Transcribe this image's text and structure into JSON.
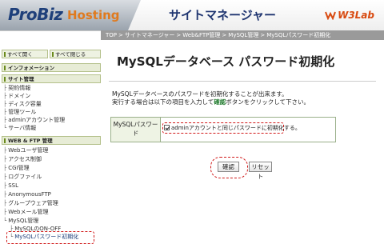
{
  "header": {
    "logo_main": "ProBiz",
    "logo_sub": "Hosting",
    "site_title": "サイトマネージャー",
    "brand": "W3Lab"
  },
  "breadcrumb": [
    "TOP",
    "サイトマネージャー",
    "Web&FTP管理",
    "MySQL管理",
    "MySQLパスワード初期化"
  ],
  "sidebar": {
    "open_all": "すべて開く",
    "close_all": "すべて閉じる",
    "sections": {
      "info": "インフォメーション",
      "site": "サイト管理",
      "webftp": "WEB & FTP 管理"
    },
    "site_items": [
      "契約情報",
      "ドメイン",
      "ディスク容量",
      "管理ツール",
      "adminアカウント管理",
      "サーバ情報"
    ],
    "webftp_items": [
      "Webユーザ管理",
      "アクセス制御",
      "CGI管理",
      "ログファイル",
      "SSL",
      "AnonymousFTP",
      "グループウェア管理",
      "Webメール管理",
      "MySQL管理"
    ],
    "mysql_items": [
      "MySQLのON-OFF",
      "MySQLパスワード初期化"
    ]
  },
  "main": {
    "title": "MySQLデータベース パスワード初期化",
    "desc_line1": "MySQLデータベースのパスワードを初期化することが出来ます。",
    "desc_line2_pre": "実行する場合は以下の項目を入力して",
    "desc_line2_kw": "確認",
    "desc_line2_post": "ボタンをクリックして下さい。",
    "form_label": "MySQLパスワード",
    "checkbox_label": "adminアカウントと同じパスワードに初期化する。",
    "checkbox_checked": true,
    "confirm_button": "確認",
    "reset_button": "リセット"
  }
}
